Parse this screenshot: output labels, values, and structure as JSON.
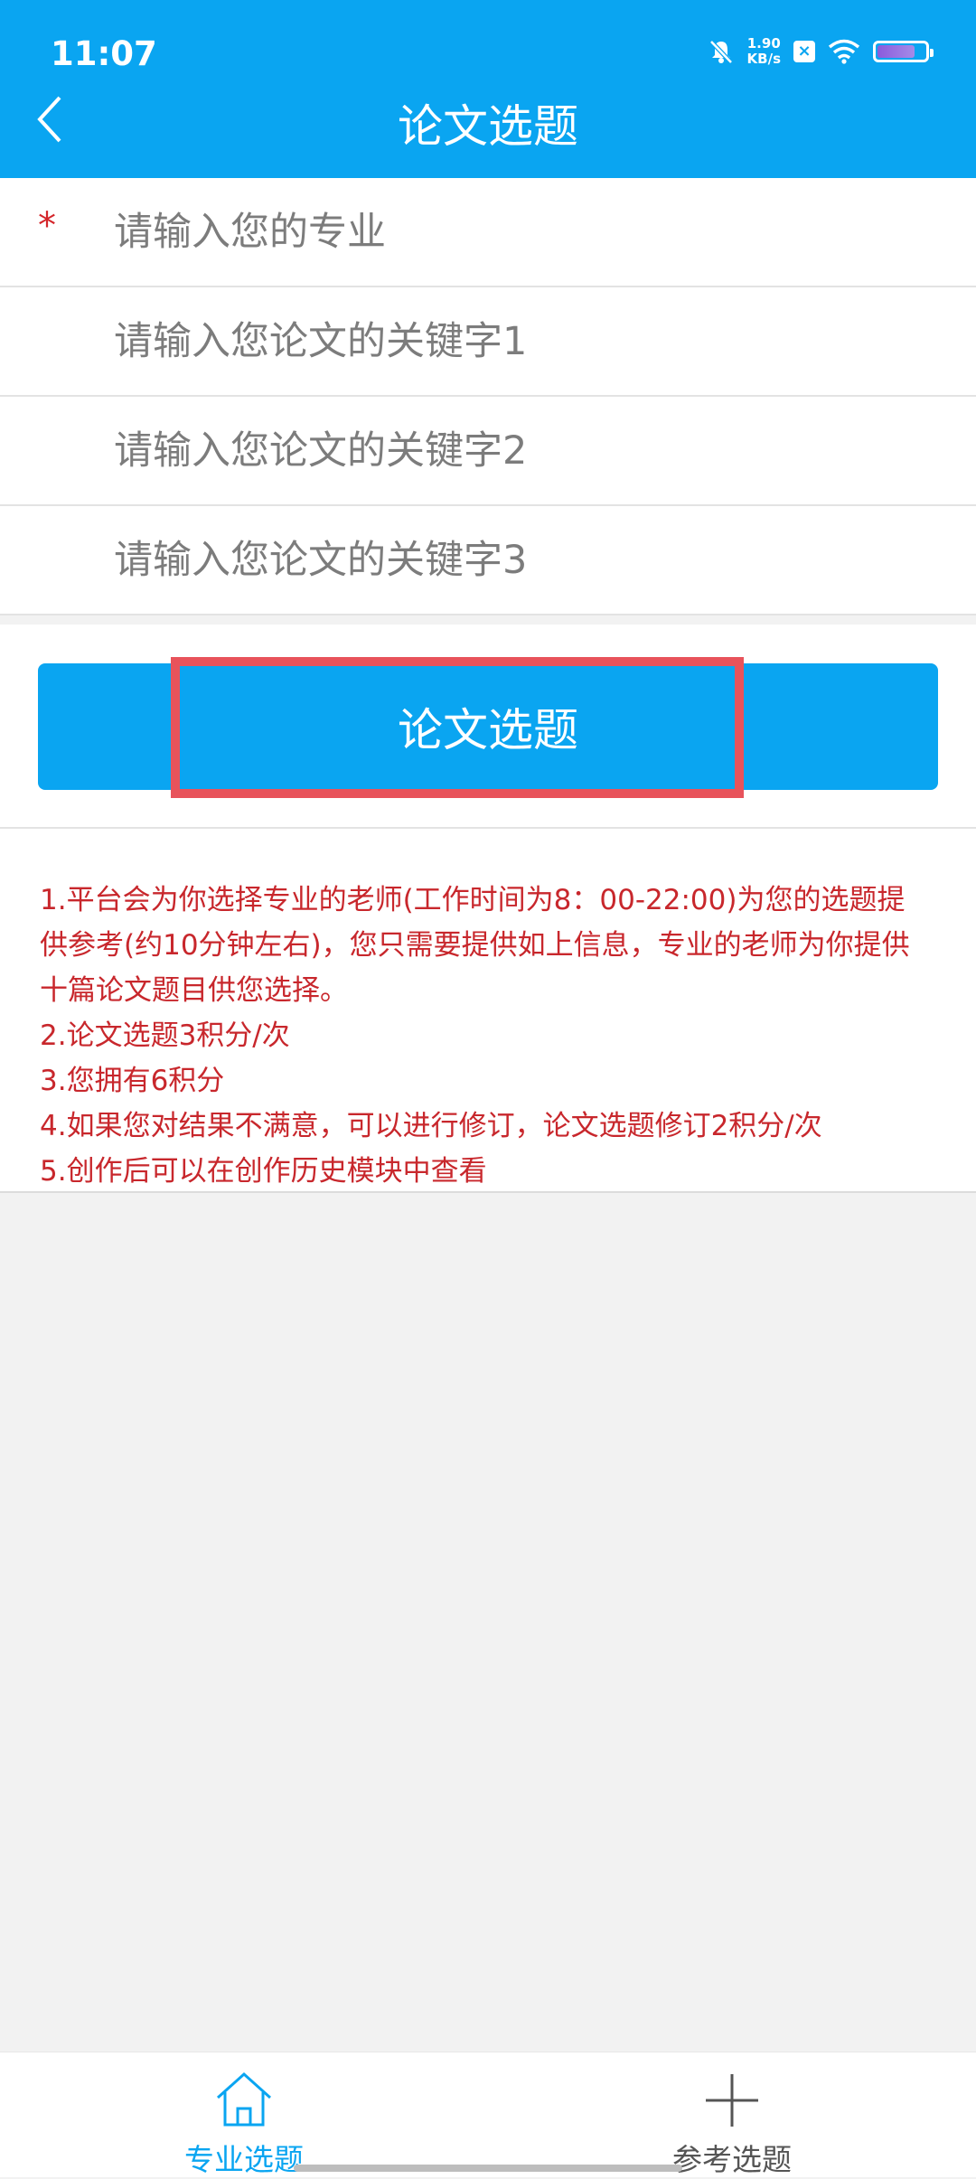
{
  "status_bar": {
    "time": "11:07",
    "net_speed_value": "1.90",
    "net_speed_unit": "KB/s",
    "icons": [
      "mute-icon",
      "x-badge-icon",
      "wifi-icon",
      "battery-icon"
    ]
  },
  "header": {
    "title": "论文选题",
    "back_icon": "chevron-left-icon"
  },
  "form": {
    "major": {
      "required_mark": "*",
      "placeholder": "请输入您的专业",
      "value": ""
    },
    "keyword1": {
      "placeholder": "请输入您论文的关键字1",
      "value": ""
    },
    "keyword2": {
      "placeholder": "请输入您论文的关键字2",
      "value": ""
    },
    "keyword3": {
      "placeholder": "请输入您论文的关键字3",
      "value": ""
    },
    "submit_label": "论文选题"
  },
  "notes": [
    "1.平台会为你选择专业的老师(工作时间为8：00-22:00)为您的选题提",
    "供参考(约10分钟左右)，您只需要提供如上信息，专业的老师为你提供",
    "十篇论文题目供您选择。",
    "2.论文选题3积分/次",
    "3.您拥有6积分",
    "4.如果您对结果不满意，可以进行修订，论文选题修订2积分/次",
    "5.创作后可以在创作历史模块中查看"
  ],
  "tabbar": {
    "tabs": [
      {
        "label": "专业选题",
        "icon": "home-icon",
        "active": true
      },
      {
        "label": "参考选题",
        "icon": "plus-icon",
        "active": false
      }
    ]
  },
  "colors": {
    "primary": "#0aa5f1",
    "active_tab": "#0aa5f1",
    "note_text": "#c8272c",
    "highlight": "#e8535b"
  }
}
